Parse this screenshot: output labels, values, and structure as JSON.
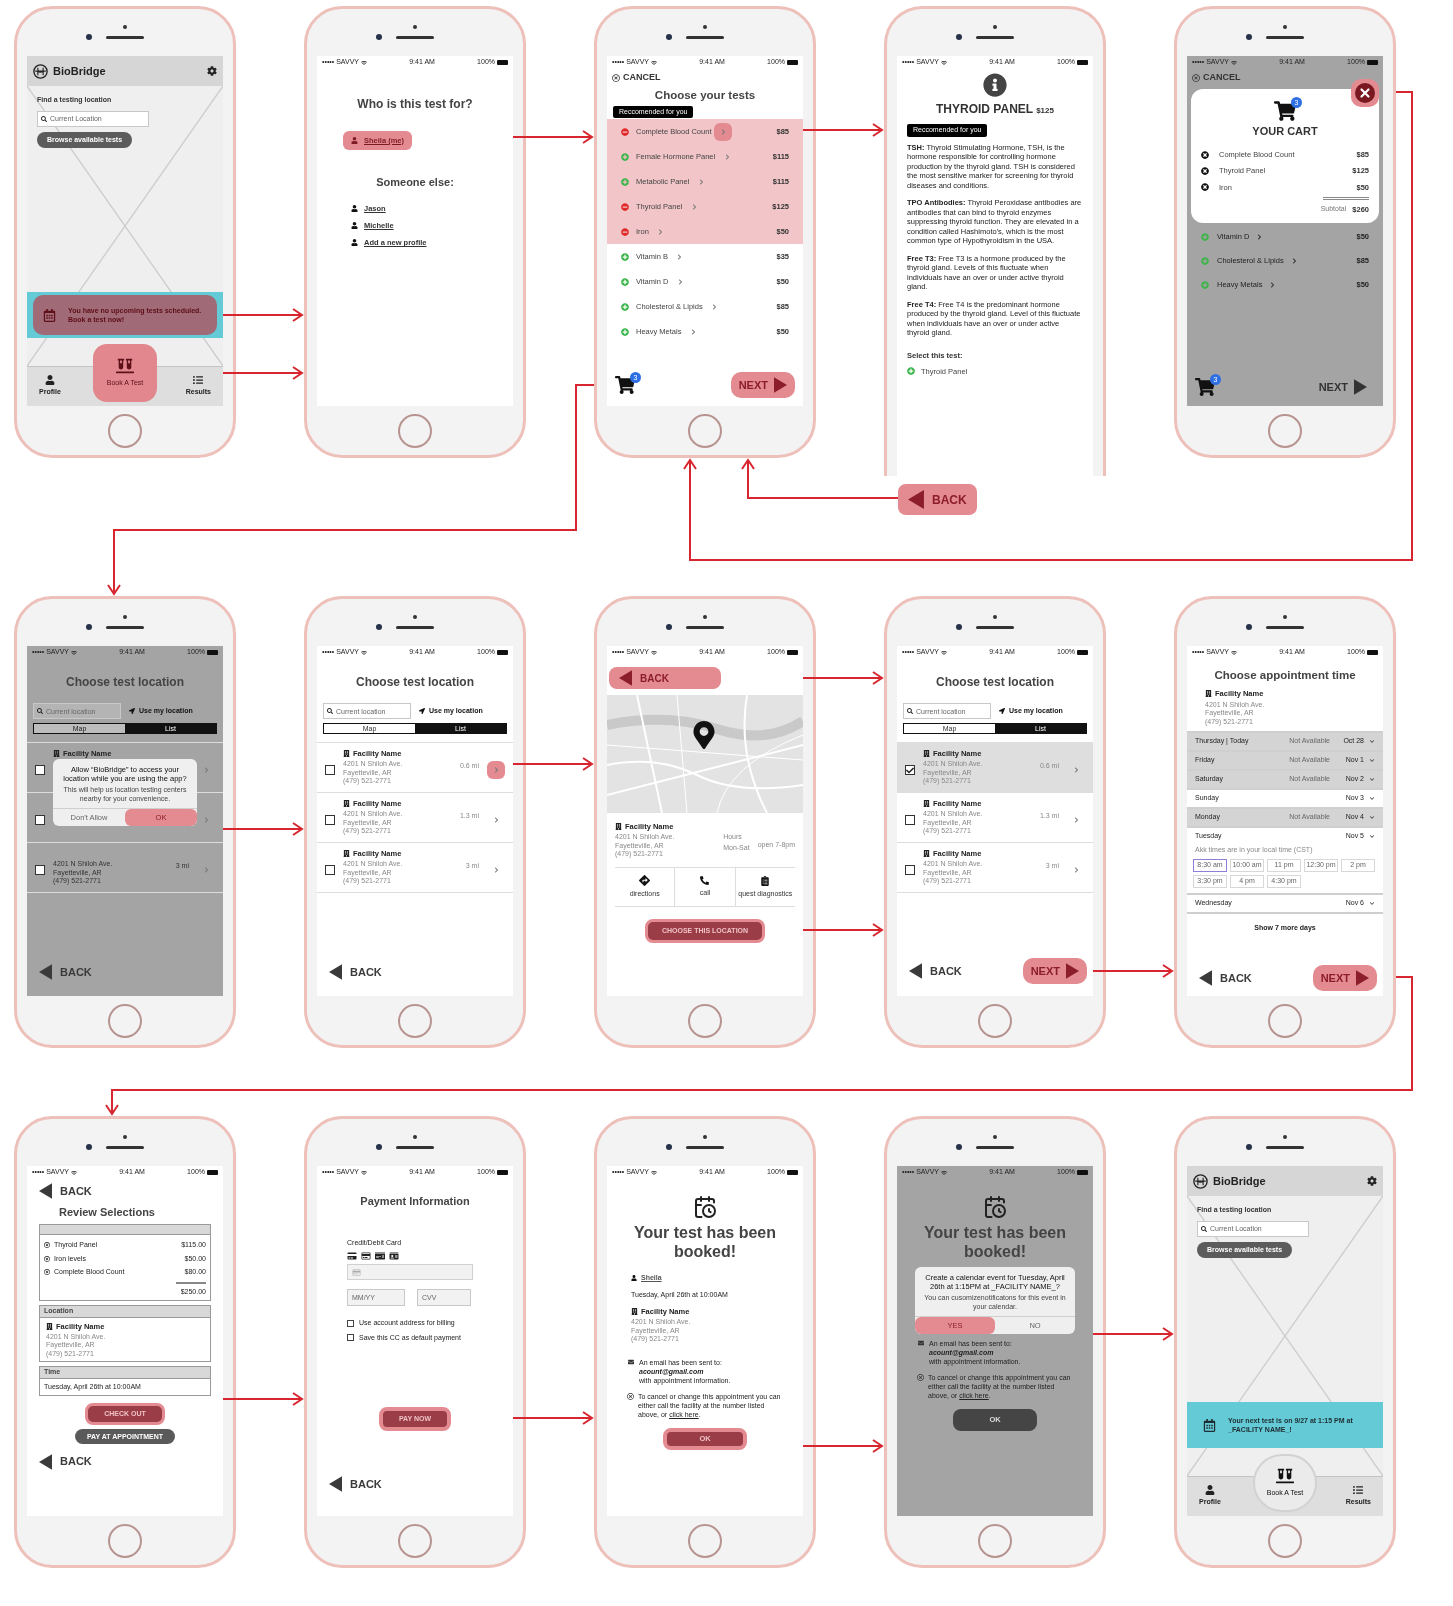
{
  "screens": [
    {
      "kind": "home",
      "header": {
        "title": "BioBridge"
      },
      "find_label": "Find a testing location",
      "search": {
        "placeholder": "Current Location"
      },
      "browse_button": "Browse available tests",
      "banner": {
        "text": "You have no upcoming tests scheduled. Book a test now!",
        "highlighted": true
      },
      "tabs": [
        {
          "label": "Profile",
          "kind": "profile"
        },
        {
          "label": "Results",
          "kind": "results"
        }
      ],
      "book_button": {
        "label": "Book A Test",
        "highlighted": true
      }
    },
    {
      "kind": "who",
      "status_bar": {
        "carrier": "••••• SAVVY",
        "time": "9:41 AM",
        "battery": "100%"
      },
      "title": "Who is this test for?",
      "self": {
        "name": "Sheila (me)",
        "highlighted": true
      },
      "others_title": "Someone else:",
      "others": [
        "Jason",
        "Michelle",
        "Add a new profile"
      ]
    },
    {
      "kind": "tests",
      "status_bar": {
        "carrier": "••••• SAVVY",
        "time": "9:41 AM",
        "battery": "100%"
      },
      "cancel": "CANCEL",
      "title": "Choose your tests",
      "badge": "Reccomended for you",
      "tests": [
        {
          "name": "Complete Blood Count",
          "price": "$85",
          "added": true,
          "recommended": true,
          "highlighted": true
        },
        {
          "name": "Female Hormone Panel",
          "price": "$115",
          "added": false,
          "recommended": true,
          "highlighted": false
        },
        {
          "name": "Metabolic Panel",
          "price": "$115",
          "added": false,
          "recommended": true,
          "highlighted": false
        },
        {
          "name": "Thyroid Panel",
          "price": "$125",
          "added": true,
          "recommended": true,
          "highlighted": false
        },
        {
          "name": "Iron",
          "price": "$50",
          "added": true,
          "recommended": true,
          "highlighted": false
        },
        {
          "name": "Vitamin B",
          "price": "$35",
          "added": false,
          "recommended": false,
          "highlighted": false
        },
        {
          "name": "Vitamin D",
          "price": "$50",
          "added": false,
          "recommended": false,
          "highlighted": false
        },
        {
          "name": "Cholesterol & Lipids",
          "price": "$85",
          "added": false,
          "recommended": false,
          "highlighted": false
        },
        {
          "name": "Heavy Metals",
          "price": "$50",
          "added": false,
          "recommended": false,
          "highlighted": false
        }
      ],
      "cart_count": "3",
      "next": {
        "label": "NEXT",
        "highlighted": true
      }
    },
    {
      "kind": "info",
      "status_bar": {
        "carrier": "••••• SAVVY",
        "time": "9:41 AM",
        "battery": "100%"
      },
      "title": "THYROID PANEL",
      "price": "$125",
      "badge": "Reccomended for you",
      "paragraphs": [
        "**TSH:** Thyroid Stimulating Hormone, TSH, is the hormone responsible for controlling hormone production by the thyroid gland. TSH is considered the most sensitive marker for screening for thyroid diseases and conditions.",
        "**TPO Antibodies:** Thyroid Peroxidase antibodies are antibodies that can bind to thyroid enzymes suppressing thyroid function. They are elevated in a condition called Hashimoto's, which is the most common type of Hypothyroidism in the USA.",
        "**Free T3:** Free T3 is a hormone produced by the thyroid gland. Levels of this fluctuate when individuals have an over or under active thyroid gland.",
        "**Free T4:** Free T4 is the predominant hormone produced by the thyroid gland. Level of this fluctuate when individuals have an over or under active thyroid gland."
      ],
      "select_label": "Select this test:",
      "option": "Thyroid Panel",
      "outside_back": {
        "label": "BACK",
        "highlighted": true
      }
    },
    {
      "kind": "cart",
      "dim": true,
      "status_bar": {
        "carrier": "••••• SAVVY",
        "time": "9:41 AM",
        "battery": "100%"
      },
      "cancel": "CANCEL",
      "close": {
        "highlighted": true
      },
      "cart_title": "YOUR CART",
      "cart_count": "3",
      "items": [
        {
          "name": "Complete Blood Count",
          "price": "$85"
        },
        {
          "name": "Thyroid Panel",
          "price": "$125"
        },
        {
          "name": "Iron",
          "price": "$50"
        }
      ],
      "subtotal_label": "Subtotal",
      "subtotal": "$260",
      "tests": [
        {
          "name": "Vitamin D",
          "price": "$50"
        },
        {
          "name": "Cholesterol & Lipids",
          "price": "$85"
        },
        {
          "name": "Heavy Metals",
          "price": "$50"
        }
      ],
      "footer_cart_count": "3",
      "next": {
        "label": "NEXT",
        "highlighted": false
      }
    },
    {
      "kind": "location",
      "dim": true,
      "status_bar": {
        "carrier": "••••• SAVVY",
        "time": "9:41 AM",
        "battery": "100%"
      },
      "title": "Choose test location",
      "search": {
        "placeholder": "Current location"
      },
      "use_location": "Use my location",
      "views": [
        {
          "label": "Map",
          "selected": false
        },
        {
          "label": "List",
          "selected": true
        }
      ],
      "facilities": [
        {
          "checked": false,
          "highlighted": false,
          "name": "Facility Name"
        },
        {
          "checked": false,
          "highlighted": false
        },
        {
          "checked": false,
          "highlighted": false,
          "address": [
            "4201 N Shiloh Ave.",
            "Fayetteville, AR",
            "(479) 521-2771"
          ],
          "distance": "3 mi"
        }
      ],
      "dialog": {
        "title": "Allow “BioBridge” to access your location while you are using the app?",
        "message": "This will help us location testing centers nearby for your convenience.",
        "buttons": [
          {
            "label": "Don't Allow",
            "highlighted": false
          },
          {
            "label": "OK",
            "highlighted": true
          }
        ]
      },
      "back": {
        "label": "BACK",
        "highlighted": false
      }
    },
    {
      "kind": "location",
      "dim": false,
      "status_bar": {
        "carrier": "••••• SAVVY",
        "time": "9:41 AM",
        "battery": "100%"
      },
      "title": "Choose test location",
      "search": {
        "placeholder": "Current location"
      },
      "use_location": "Use my location",
      "views": [
        {
          "label": "Map",
          "selected": false
        },
        {
          "label": "List",
          "selected": true
        }
      ],
      "facilities": [
        {
          "checked": false,
          "highlighted": true,
          "name": "Facility Name",
          "address": [
            "4201 N Shiloh Ave.",
            "Fayetteville, AR",
            "(479) 521-2771"
          ],
          "distance": "0.6 mi"
        },
        {
          "checked": false,
          "highlighted": false,
          "name": "Facility Name",
          "address": [
            "4201 N Shiloh Ave.",
            "Fayetteville, AR",
            "(479) 521-2771"
          ],
          "distance": "1.3 mi"
        },
        {
          "checked": false,
          "highlighted": false,
          "name": "Facility Name",
          "address": [
            "4201 N Shiloh Ave.",
            "Fayetteville, AR",
            "(479) 521-2771"
          ],
          "distance": "3 mi"
        }
      ],
      "back": {
        "label": "BACK",
        "highlighted": false
      }
    },
    {
      "kind": "facility",
      "status_bar": {
        "carrier": "••••• SAVVY",
        "time": "9:41 AM",
        "battery": "100%"
      },
      "back": {
        "label": "BACK",
        "highlighted": true
      },
      "facility": {
        "name": "Facility Name",
        "address": [
          "4201 N Shiloh Ave.",
          "Fayetteville, AR",
          "(479) 521-2771"
        ]
      },
      "hours_label": "Hours",
      "days": "Mon-Sat",
      "hours": "open 7-8pm",
      "actions": [
        {
          "label": "directions",
          "kind": "directions"
        },
        {
          "label": "call",
          "kind": "call"
        },
        {
          "label": "quest diagnostics",
          "kind": "provider"
        }
      ],
      "choose": {
        "label": "CHOOSE THIS LOCATION",
        "highlighted": true
      }
    },
    {
      "kind": "location",
      "dim": false,
      "status_bar": {
        "carrier": "••••• SAVVY",
        "time": "9:41 AM",
        "battery": "100%"
      },
      "title": "Choose test location",
      "search": {
        "placeholder": "Current location"
      },
      "use_location": "Use my location",
      "views": [
        {
          "label": "Map",
          "selected": false
        },
        {
          "label": "List",
          "selected": true
        }
      ],
      "facilities": [
        {
          "checked": true,
          "highlighted": false,
          "name": "Facility Name",
          "address": [
            "4201 N Shiloh Ave.",
            "Fayetteville, AR",
            "(479) 521-2771"
          ],
          "distance": "0.6 mi"
        },
        {
          "checked": false,
          "highlighted": false,
          "name": "Facility Name",
          "address": [
            "4201 N Shiloh Ave.",
            "Fayetteville, AR",
            "(479) 521-2771"
          ],
          "distance": "1.3 mi"
        },
        {
          "checked": false,
          "highlighted": false,
          "name": "Facility Name",
          "address": [
            "4201 N Shiloh Ave.",
            "Fayetteville, AR",
            "(479) 521-2771"
          ],
          "distance": "3 mi"
        }
      ],
      "back": {
        "label": "BACK",
        "highlighted": false
      },
      "next": {
        "label": "NEXT",
        "highlighted": true
      }
    },
    {
      "kind": "time",
      "status_bar": {
        "carrier": "••••• SAVVY",
        "time": "9:41 AM",
        "battery": "100%"
      },
      "title": "Choose appointment time",
      "facility": {
        "name": "Facility Name",
        "address": [
          "4201 N Shiloh Ave.",
          "Fayetteville, AR",
          "(479) 521-2771"
        ]
      },
      "days": [
        {
          "day": "Thursday | Today",
          "status": "Not Available",
          "date": "Oct 28",
          "available": false
        },
        {
          "day": "Friday",
          "status": "Not Available",
          "date": "Nov 1",
          "available": false
        },
        {
          "day": "Saturday",
          "status": "Not Available",
          "date": "Nov 2",
          "available": false
        },
        {
          "day": "Sunday",
          "date": "Nov 3",
          "available": true
        },
        {
          "day": "Monday",
          "status": "Not Available",
          "date": "Nov 4",
          "available": false
        },
        {
          "day": "Tuesday",
          "date": "Nov 5",
          "available": true,
          "note": "Akk times are in your local time (CST)",
          "slots": [
            {
              "label": "8:30 am",
              "selected": true
            },
            {
              "label": "10:00 am",
              "selected": false
            },
            {
              "label": "11 pm",
              "selected": false
            },
            {
              "label": "12:30 pm",
              "selected": false
            },
            {
              "label": "2 pm",
              "selected": false
            },
            {
              "label": "3:30 pm",
              "selected": false
            },
            {
              "label": "4 pm",
              "selected": false
            },
            {
              "label": "4:30 pm",
              "selected": false
            }
          ]
        },
        {
          "day": "Wednesday",
          "date": "Nov 6",
          "available": true
        }
      ],
      "more": "Show 7 more days",
      "back": {
        "label": "BACK",
        "highlighted": false
      },
      "next": {
        "label": "NEXT",
        "highlighted": true
      }
    },
    {
      "kind": "review",
      "status_bar": {
        "carrier": "••••• SAVVY",
        "time": "9:41 AM",
        "battery": "100%"
      },
      "back_top": {
        "label": "BACK"
      },
      "title": "Review Selections",
      "items": [
        {
          "name": "Thyroid Panel",
          "price": "$115.00"
        },
        {
          "name": "Iron levels",
          "price": "$50.00"
        },
        {
          "name": "Complete Blood Count",
          "price": "$80.00"
        }
      ],
      "total": "$250.00",
      "location": {
        "title": "Location",
        "facility": {
          "name": "Facility Name",
          "address": [
            "4201 N Shiloh Ave.",
            "Fayetteville, AR",
            "(479) 521-2771"
          ]
        }
      },
      "time": {
        "title": "Time",
        "value": "Tuesday, April 26th at 10:00AM"
      },
      "checkout": {
        "label": "CHECK OUT",
        "highlighted": true
      },
      "pay_later": "PAY AT APPOINTMENT",
      "back": {
        "label": "BACK",
        "highlighted": false
      }
    },
    {
      "kind": "payment",
      "status_bar": {
        "carrier": "••••• SAVVY",
        "time": "9:41 AM",
        "battery": "100%"
      },
      "title": "Payment Information",
      "card_label": "Credit/Debit Card",
      "expiry": {
        "placeholder": "MM/YY"
      },
      "cvv": {
        "placeholder": "CVV"
      },
      "options": [
        {
          "label": "Use account address for billing",
          "checked": false
        },
        {
          "label": "Save this CC as default payment",
          "checked": false
        }
      ],
      "pay": {
        "label": "PAY NOW",
        "highlighted": true
      },
      "back": {
        "label": "BACK",
        "highlighted": false
      }
    },
    {
      "kind": "booked",
      "dim": false,
      "status_bar": {
        "carrier": "••••• SAVVY",
        "time": "9:41 AM",
        "battery": "100%"
      },
      "title": "Your test has been booked!",
      "person": "Sheila",
      "date": "Tuesday, April 26th at 10:00AM",
      "facility": {
        "name": "Facility Name",
        "address": [
          "4201 N Shiloh Ave.",
          "Fayetteville, AR",
          "(479) 521-2771"
        ]
      },
      "email": {
        "lead": "An email has been sent to:",
        "address": "acount@gmail.com",
        "tail": "with appointment information."
      },
      "cancel_note": {
        "text": "To cancel or change this appointment you can either call the facility at the number listed above, or",
        "link": "click here",
        "end": "."
      },
      "ok": {
        "label": "OK",
        "highlighted": true
      }
    },
    {
      "kind": "booked",
      "dim": true,
      "status_bar": {
        "carrier": "••••• SAVVY",
        "time": "9:41 AM",
        "battery": "100%"
      },
      "title": "Your test has been booked!",
      "dialog": {
        "title": "Create a calendar event for Tuesday, April 26th at 1:15PM at _FACILITY NAME_?",
        "message": "You can cusomizenotificatons for this event in your calendar.",
        "buttons": [
          {
            "label": "YES",
            "highlighted": true
          },
          {
            "label": "NO",
            "highlighted": false
          }
        ]
      },
      "email": {
        "lead": "An email has been sent to:",
        "address": "acount@gmail.com",
        "tail": "with appointment information."
      },
      "cancel_note": {
        "text": "To cancel or change this appointment you can either call the facility at the number listed above, or",
        "link": "click here",
        "end": "."
      },
      "ok": {
        "label": "OK",
        "highlighted": false
      }
    },
    {
      "kind": "home",
      "header": {
        "title": "BioBridge"
      },
      "find_label": "Find a testing location",
      "search": {
        "placeholder": "Current Location"
      },
      "browse_button": "Browse available tests",
      "banner": {
        "text": "Your next test is on 9/27 at 1:15 PM at _FACILITY NAME_!",
        "highlighted": false
      },
      "tabs": [
        {
          "label": "Profile",
          "kind": "profile"
        },
        {
          "label": "Results",
          "kind": "results"
        }
      ],
      "book_button": {
        "label": "Book A Test",
        "highlighted": false
      }
    }
  ]
}
